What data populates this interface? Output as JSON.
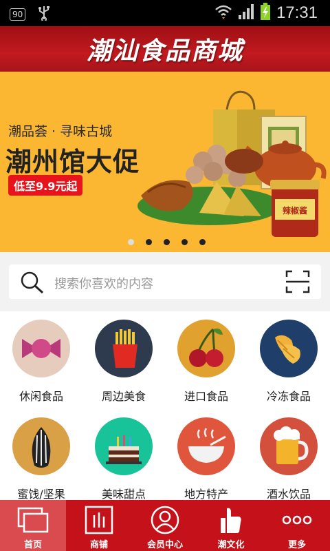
{
  "status_bar": {
    "battery_percent": "90",
    "time": "17:31"
  },
  "header": {
    "title": "潮汕食品商城"
  },
  "banner": {
    "subtitle": "潮品荟 · 寻味古城",
    "headline": "潮州馆大促",
    "price_tag": "低至9.9元起",
    "product_label": "辣椒酱",
    "dots_count": 5,
    "active_dot": 0
  },
  "search": {
    "placeholder": "搜索你喜欢的内容"
  },
  "categories": [
    {
      "label": "休闲食品",
      "icon": "candy-icon",
      "color": "#e6ccbd"
    },
    {
      "label": "周边美食",
      "icon": "fries-icon",
      "color": "#2e3a4d"
    },
    {
      "label": "进口食品",
      "icon": "cherry-icon",
      "color": "#e0a12e"
    },
    {
      "label": "冷冻食品",
      "icon": "chicken-wings-icon",
      "color": "#1f3f6a"
    },
    {
      "label": "蜜饯/坚果",
      "icon": "sunflower-seed-icon",
      "color": "#d9a046"
    },
    {
      "label": "美味甜点",
      "icon": "cake-icon",
      "color": "#19c39a"
    },
    {
      "label": "地方特产",
      "icon": "bowl-icon",
      "color": "#e0563c"
    },
    {
      "label": "酒水饮品",
      "icon": "beer-icon",
      "color": "#d2503c"
    }
  ],
  "tabs": [
    {
      "label": "首页",
      "icon": "home-icon",
      "active": true
    },
    {
      "label": "商铺",
      "icon": "shop-icon",
      "active": false
    },
    {
      "label": "会员中心",
      "icon": "user-icon",
      "active": false
    },
    {
      "label": "潮文化",
      "icon": "thumbs-up-icon",
      "active": false
    },
    {
      "label": "更多",
      "icon": "more-icon",
      "active": false
    }
  ]
}
